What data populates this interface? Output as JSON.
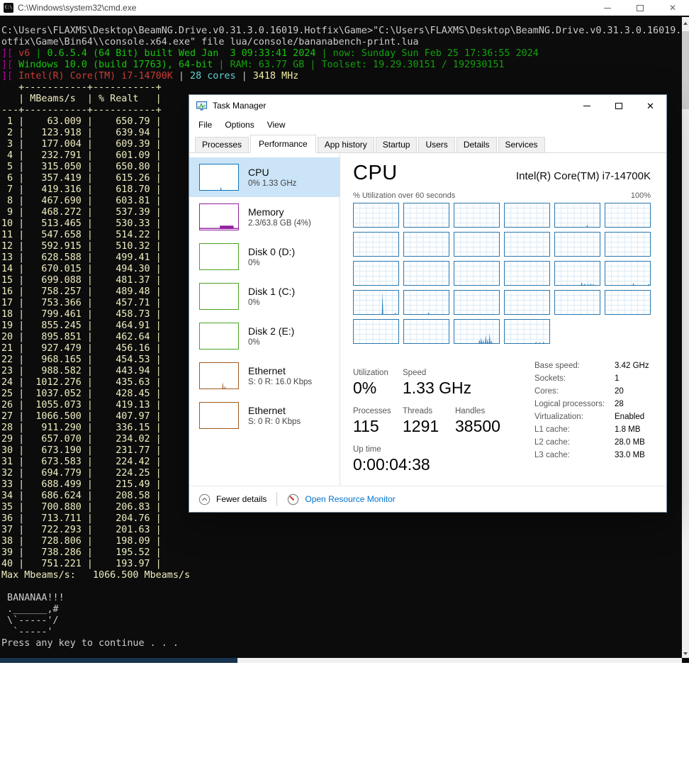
{
  "palette": {
    "purple": "#b4009e",
    "red": "#c83c37",
    "green_bright": "#16c60c",
    "green": "#13a10e",
    "cyan": "#61d6d6",
    "yellow": "#f9f1a5",
    "gray": "#cccccc",
    "cream": "#f0eec0",
    "cpu_blue": "#1177bb",
    "mem_purple": "#91219e",
    "disk_green": "#4aa323",
    "eth_brown": "#a15a20",
    "selected_bg": "#cbe4f7",
    "link_blue": "#0073cf"
  },
  "icons": {
    "close": "✕"
  },
  "console": {
    "title": "C:\\Windows\\system32\\cmd.exe",
    "lines": [
      {
        "seg": [
          [
            "gray",
            "C:\\Users\\FLAXMS\\Desktop\\BeamNG.Drive.v0.31.3.0.16019.Hotfix\\Game>\"C:\\Users\\FLAXMS\\Desktop\\BeamNG.Drive.v0.31.3.0.16019.H"
          ]
        ]
      },
      {
        "seg": [
          [
            "gray",
            "otfix\\Game\\Bin64\\\\console.x64.exe\" file lua/console/bananabench-print.lua"
          ]
        ]
      },
      {
        "seg": [
          [
            "purple",
            "]["
          ],
          [
            "red",
            " v6 "
          ],
          [
            "green",
            "| "
          ],
          [
            "green_bright",
            "0.6.5.4 (64 Bit) built Wed Jan  3 09:33:41 2024"
          ],
          [
            "green",
            " | now: Sunday Sun Feb 25 17:36:55 2024"
          ]
        ]
      },
      {
        "seg": [
          [
            "purple",
            "]["
          ],
          [
            "green_bright",
            " Windows 10.0 (build 17763), 64-bit "
          ],
          [
            "green",
            "| RAM: 63.77 GB | Toolset: 19.29.30151 / 192930151"
          ]
        ]
      },
      {
        "seg": [
          [
            "purple",
            "]["
          ],
          [
            "red",
            " Intel(R) Core(TM) i7-14700K "
          ],
          [
            "gray",
            "| "
          ],
          [
            "cyan",
            "28 cores"
          ],
          [
            "gray",
            " | "
          ],
          [
            "yellow",
            "3418 MHz"
          ]
        ]
      },
      {
        "table": "bench"
      },
      {
        "seg": [
          [
            "cream",
            "Max Mbeams/s:   1066.500 Mbeams/s"
          ]
        ]
      },
      {
        "seg": []
      },
      {
        "seg": [
          [
            "gray",
            " BANANAA!!!"
          ]
        ]
      },
      {
        "seg": [
          [
            "gray",
            " .______,#"
          ]
        ]
      },
      {
        "seg": [
          [
            "gray",
            " \\`-----'/"
          ]
        ]
      },
      {
        "seg": [
          [
            "gray",
            "  `-----'"
          ]
        ]
      },
      {
        "seg": [
          [
            "gray",
            "Press any key to continue . . ."
          ]
        ]
      }
    ],
    "bench_table": {
      "color": "cream",
      "headers": [
        "MBeams/s",
        "% Realt"
      ],
      "rows": [
        [
          63.009,
          650.79
        ],
        [
          123.918,
          639.94
        ],
        [
          177.004,
          609.39
        ],
        [
          232.791,
          601.09
        ],
        [
          315.05,
          650.8
        ],
        [
          357.419,
          615.26
        ],
        [
          419.316,
          618.7
        ],
        [
          467.69,
          603.81
        ],
        [
          468.272,
          537.39
        ],
        [
          513.465,
          530.33
        ],
        [
          547.658,
          514.22
        ],
        [
          592.915,
          510.32
        ],
        [
          628.588,
          499.41
        ],
        [
          670.015,
          494.3
        ],
        [
          699.088,
          481.37
        ],
        [
          758.257,
          489.48
        ],
        [
          753.366,
          457.71
        ],
        [
          799.461,
          458.73
        ],
        [
          855.245,
          464.91
        ],
        [
          895.851,
          462.64
        ],
        [
          927.479,
          456.16
        ],
        [
          968.165,
          454.53
        ],
        [
          988.582,
          443.94
        ],
        [
          1012.276,
          435.63
        ],
        [
          1037.052,
          428.45
        ],
        [
          1055.073,
          419.13
        ],
        [
          1066.5,
          407.97
        ],
        [
          911.29,
          336.15
        ],
        [
          657.07,
          234.02
        ],
        [
          673.19,
          231.77
        ],
        [
          673.583,
          224.42
        ],
        [
          694.779,
          224.25
        ],
        [
          688.499,
          215.49
        ],
        [
          686.624,
          208.58
        ],
        [
          700.88,
          206.83
        ],
        [
          713.711,
          204.76
        ],
        [
          722.293,
          201.63
        ],
        [
          728.806,
          198.09
        ],
        [
          738.286,
          195.52
        ],
        [
          751.221,
          193.97
        ]
      ]
    }
  },
  "task_manager": {
    "title": "Task Manager",
    "menu": [
      "File",
      "Options",
      "View"
    ],
    "tabs": {
      "labels": [
        "Processes",
        "Performance",
        "App history",
        "Startup",
        "Users",
        "Details",
        "Services"
      ],
      "active_index": 1
    },
    "sidebar": [
      {
        "id": "cpu",
        "label": "CPU",
        "sub": "0% 1.33 GHz",
        "color": "#1177bb",
        "selected": true,
        "spark": [
          [
            0.55,
            0.12
          ]
        ]
      },
      {
        "id": "memory",
        "label": "Memory",
        "sub": "2.3/63.8 GB (4%)",
        "color": "#91219e",
        "mem_fill": true
      },
      {
        "id": "disk-0",
        "label": "Disk 0 (D:)",
        "sub": "0%",
        "color": "#4aa323"
      },
      {
        "id": "disk-1",
        "label": "Disk 1 (C:)",
        "sub": "0%",
        "color": "#4aa323"
      },
      {
        "id": "disk-2",
        "label": "Disk 2 (E:)",
        "sub": "0%",
        "color": "#4aa323"
      },
      {
        "id": "ethernet-1",
        "label": "Ethernet",
        "sub": "S: 0 R: 16.0 Kbps",
        "color": "#a15a20",
        "spark": [
          [
            0.6,
            0.26
          ],
          [
            0.655,
            0.1
          ]
        ]
      },
      {
        "id": "ethernet-2",
        "label": "Ethernet",
        "sub": "S: 0 R: 0 Kbps",
        "color": "#a15a20"
      }
    ],
    "cpu": {
      "heading": "CPU",
      "processor": "Intel(R) Core(TM) i7-14700K",
      "graph_label": "% Utilization over 60 seconds",
      "graph_max": "100%",
      "grid": {
        "spike_color": "#2f84c0",
        "cells": [
          [],
          [],
          [],
          [],
          [
            [
              0.72,
              0.1
            ]
          ],
          [],
          [],
          [],
          [],
          [],
          [],
          [],
          [],
          [],
          [],
          [],
          [
            [
              0.6,
              0.13
            ],
            [
              0.66,
              0.06
            ],
            [
              0.74,
              0.05
            ],
            [
              0.8,
              0.07
            ],
            [
              0.86,
              0.04
            ]
          ],
          [
            [
              0.63,
              0.09
            ],
            [
              0.97,
              0.05
            ]
          ],
          [
            [
              0.645,
              0.97
            ],
            [
              0.93,
              0.06
            ]
          ],
          [
            [
              0.55,
              0.08
            ]
          ],
          [],
          [],
          [],
          [],
          [],
          [],
          [
            [
              0.56,
              0.16
            ],
            [
              0.6,
              0.24
            ],
            [
              0.645,
              0.14
            ],
            [
              0.7,
              0.36
            ],
            [
              0.745,
              0.18
            ],
            [
              0.79,
              0.45
            ],
            [
              0.83,
              0.12
            ]
          ],
          [
            [
              0.7,
              0.05
            ],
            [
              0.78,
              0.04
            ],
            [
              0.87,
              0.06
            ]
          ]
        ]
      },
      "stats": {
        "utilization": {
          "label": "Utilization",
          "value": "0%"
        },
        "speed": {
          "label": "Speed",
          "value": "1.33 GHz"
        },
        "processes": {
          "label": "Processes",
          "value": "115"
        },
        "threads": {
          "label": "Threads",
          "value": "1291"
        },
        "handles": {
          "label": "Handles",
          "value": "38500"
        },
        "uptime": {
          "label": "Up time",
          "value": "0:00:04:38"
        }
      },
      "details": [
        {
          "label": "Base speed:",
          "value": "3.42 GHz"
        },
        {
          "label": "Sockets:",
          "value": "1"
        },
        {
          "label": "Cores:",
          "value": "20"
        },
        {
          "label": "Logical processors:",
          "value": "28"
        },
        {
          "label": "Virtualization:",
          "value": "Enabled"
        },
        {
          "label": "L1 cache:",
          "value": "1.8 MB"
        },
        {
          "label": "L2 cache:",
          "value": "28.0 MB"
        },
        {
          "label": "L3 cache:",
          "value": "33.0 MB"
        }
      ]
    },
    "footer": {
      "fewer_details": "Fewer details",
      "open_resource_monitor": "Open Resource Monitor"
    }
  }
}
